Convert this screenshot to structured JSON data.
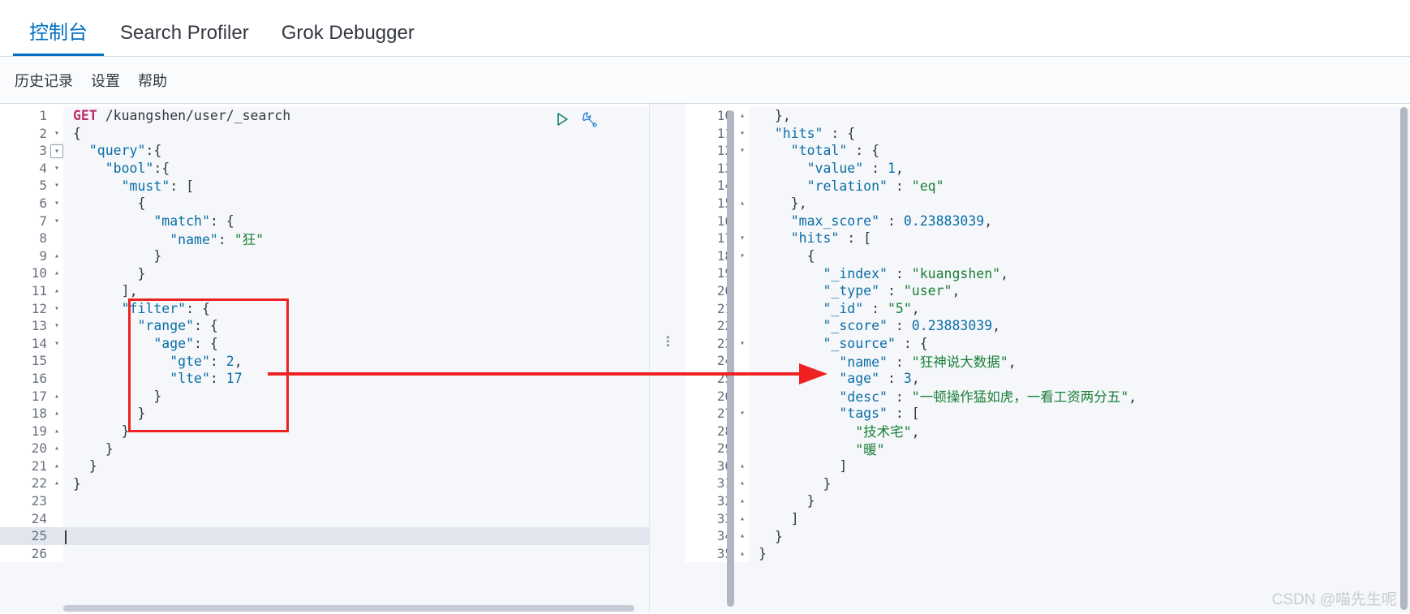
{
  "tabs": [
    {
      "label": "控制台",
      "active": true
    },
    {
      "label": "Search Profiler",
      "active": false
    },
    {
      "label": "Grok Debugger",
      "active": false
    }
  ],
  "submenu": [
    {
      "label": "历史记录"
    },
    {
      "label": "设置"
    },
    {
      "label": "帮助"
    }
  ],
  "actions": {
    "play_icon": "play-icon",
    "wrench_icon": "wrench-icon"
  },
  "request_editor": {
    "method": "GET",
    "path": "/kuangshen/user/_search",
    "active_line": 25,
    "lines": [
      {
        "n": 1,
        "fold": "",
        "text": "GET /kuangshen/user/_search"
      },
      {
        "n": 2,
        "fold": "▾",
        "text": "{"
      },
      {
        "n": 3,
        "fold": "▾",
        "text": "  \"query\":{"
      },
      {
        "n": 4,
        "fold": "▾",
        "text": "    \"bool\":{"
      },
      {
        "n": 5,
        "fold": "▾",
        "text": "      \"must\": ["
      },
      {
        "n": 6,
        "fold": "▾",
        "text": "        {"
      },
      {
        "n": 7,
        "fold": "▾",
        "text": "          \"match\": {"
      },
      {
        "n": 8,
        "fold": "",
        "text": "            \"name\": \"狂\""
      },
      {
        "n": 9,
        "fold": "▴",
        "text": "          }"
      },
      {
        "n": 10,
        "fold": "▴",
        "text": "        }"
      },
      {
        "n": 11,
        "fold": "▴",
        "text": "      ],"
      },
      {
        "n": 12,
        "fold": "▾",
        "text": "      \"filter\": {"
      },
      {
        "n": 13,
        "fold": "▾",
        "text": "        \"range\": {"
      },
      {
        "n": 14,
        "fold": "▾",
        "text": "          \"age\": {"
      },
      {
        "n": 15,
        "fold": "",
        "text": "            \"gte\": 2,"
      },
      {
        "n": 16,
        "fold": "",
        "text": "            \"lte\": 17"
      },
      {
        "n": 17,
        "fold": "▴",
        "text": "          }"
      },
      {
        "n": 18,
        "fold": "▴",
        "text": "        }"
      },
      {
        "n": 19,
        "fold": "▴",
        "text": "      }"
      },
      {
        "n": 20,
        "fold": "▴",
        "text": "    }"
      },
      {
        "n": 21,
        "fold": "▴",
        "text": "  }"
      },
      {
        "n": 22,
        "fold": "▴",
        "text": "}"
      },
      {
        "n": 23,
        "fold": "",
        "text": ""
      },
      {
        "n": 24,
        "fold": "",
        "text": ""
      },
      {
        "n": 25,
        "fold": "",
        "text": ""
      },
      {
        "n": 26,
        "fold": "",
        "text": ""
      }
    ]
  },
  "response_editor": {
    "lines": [
      {
        "n": 10,
        "fold": "▴",
        "text": "  },"
      },
      {
        "n": 11,
        "fold": "▾",
        "text": "  \"hits\" : {"
      },
      {
        "n": 12,
        "fold": "▾",
        "text": "    \"total\" : {"
      },
      {
        "n": 13,
        "fold": "",
        "text": "      \"value\" : 1,"
      },
      {
        "n": 14,
        "fold": "",
        "text": "      \"relation\" : \"eq\""
      },
      {
        "n": 15,
        "fold": "▴",
        "text": "    },"
      },
      {
        "n": 16,
        "fold": "",
        "text": "    \"max_score\" : 0.23883039,"
      },
      {
        "n": 17,
        "fold": "▾",
        "text": "    \"hits\" : ["
      },
      {
        "n": 18,
        "fold": "▾",
        "text": "      {"
      },
      {
        "n": 19,
        "fold": "",
        "text": "        \"_index\" : \"kuangshen\","
      },
      {
        "n": 20,
        "fold": "",
        "text": "        \"_type\" : \"user\","
      },
      {
        "n": 21,
        "fold": "",
        "text": "        \"_id\" : \"5\","
      },
      {
        "n": 22,
        "fold": "",
        "text": "        \"_score\" : 0.23883039,"
      },
      {
        "n": 23,
        "fold": "▾",
        "text": "        \"_source\" : {"
      },
      {
        "n": 24,
        "fold": "",
        "text": "          \"name\" : \"狂神说大数据\","
      },
      {
        "n": 25,
        "fold": "",
        "text": "          \"age\" : 3,"
      },
      {
        "n": 26,
        "fold": "",
        "text": "          \"desc\" : \"一顿操作猛如虎，一看工资两分五\","
      },
      {
        "n": 27,
        "fold": "▾",
        "text": "          \"tags\" : ["
      },
      {
        "n": 28,
        "fold": "",
        "text": "            \"技术宅\","
      },
      {
        "n": 29,
        "fold": "",
        "text": "            \"暖\""
      },
      {
        "n": 30,
        "fold": "▴",
        "text": "          ]"
      },
      {
        "n": 31,
        "fold": "▴",
        "text": "        }"
      },
      {
        "n": 32,
        "fold": "▴",
        "text": "      }"
      },
      {
        "n": 33,
        "fold": "▴",
        "text": "    ]"
      },
      {
        "n": 34,
        "fold": "▴",
        "text": "  }"
      },
      {
        "n": 35,
        "fold": "▴",
        "text": "}"
      }
    ]
  },
  "annotations": {
    "highlight_box_label": "filter-range-highlight",
    "arrow_label": "filter-to-age-arrow",
    "arrow_color": "#ee2222",
    "box_color": "#ee2222"
  },
  "watermark": "CSDN @喵先生呢",
  "colors": {
    "accent": "#0071c2",
    "method": "#bd2e6b",
    "key": "#0a6ea6",
    "string": "#1a7f37",
    "play": "#127b72",
    "wrench": "#2a7fd4"
  }
}
